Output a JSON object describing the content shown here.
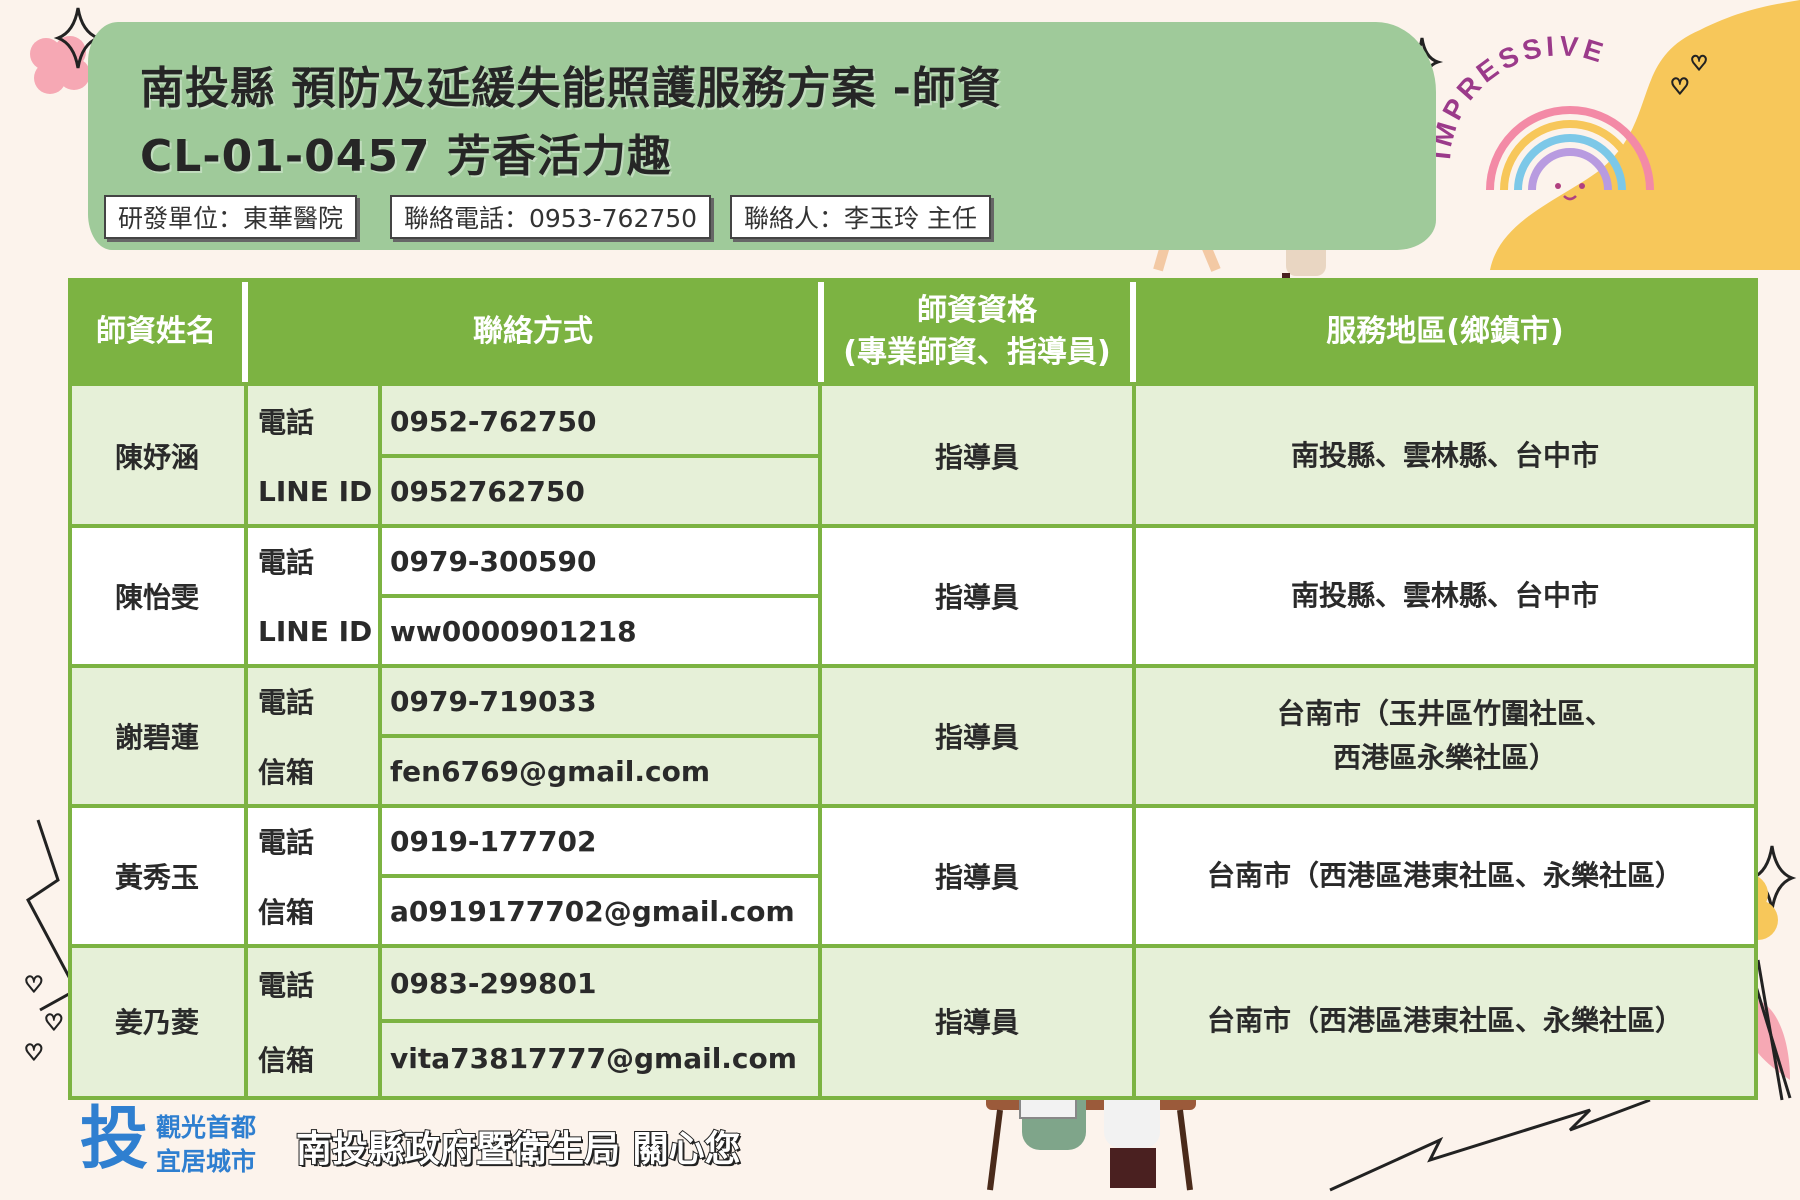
{
  "header": {
    "title_line1": "南投縣 預防及延緩失能照護服務方案 -師資",
    "title_line2": "CL-01-0457 芳香活力趣",
    "dev_unit": "研發單位：東華醫院",
    "phone": "聯絡電話：0953-762750",
    "contact": "聯絡人：李玉玲  主任"
  },
  "decor": {
    "impressive": "IMPRESSIVE"
  },
  "table": {
    "headers": {
      "name": "師資姓名",
      "contact": "聯絡方式",
      "qual_line1": "師資資格",
      "qual_line2": "(專業師資、指導員)",
      "area": "服務地區(鄉鎮市)"
    },
    "rows": [
      {
        "name": "陳妤涵",
        "c1_label": "電話",
        "c1_value": "0952-762750",
        "c2_label": "LINE ID",
        "c2_value": "0952762750",
        "qual": "指導員",
        "area_line1": "南投縣、雲林縣、台中市",
        "area_line2": ""
      },
      {
        "name": "陳怡雯",
        "c1_label": "電話",
        "c1_value": "0979-300590",
        "c2_label": "LINE ID",
        "c2_value": "ww0000901218",
        "qual": "指導員",
        "area_line1": "南投縣、雲林縣、台中市",
        "area_line2": ""
      },
      {
        "name": "謝碧蓮",
        "c1_label": "電話",
        "c1_value": "0979-719033",
        "c2_label": "信箱",
        "c2_value": "fen6769@gmail.com",
        "qual": "指導員",
        "area_line1": "台南市（玉井區竹圍社區、",
        "area_line2": "西港區永樂社區）"
      },
      {
        "name": "黃秀玉",
        "c1_label": "電話",
        "c1_value": "0919-177702",
        "c2_label": "信箱",
        "c2_value": "a0919177702@gmail.com",
        "qual": "指導員",
        "area_line1": "台南市（西港區港東社區、永樂社區）",
        "area_line2": ""
      },
      {
        "name": "姜乃菱",
        "c1_label": "電話",
        "c1_value": "0983-299801",
        "c2_label": "信箱",
        "c2_value": "vita73817777@gmail.com",
        "qual": "指導員",
        "area_line1": "台南市（西港區港東社區、永樂社區）",
        "area_line2": ""
      }
    ]
  },
  "footer": {
    "logo_char": "投",
    "logo_line1": "觀光首都",
    "logo_line2": "宜居城市",
    "message": "南投縣政府暨衛生局 關心您"
  },
  "colors": {
    "header_green": "#9fca9a",
    "table_green": "#7cb342",
    "row_tint": "#e6f0d8",
    "logo_blue": "#2f7fd0",
    "accent_yellow": "#f7c75a"
  }
}
